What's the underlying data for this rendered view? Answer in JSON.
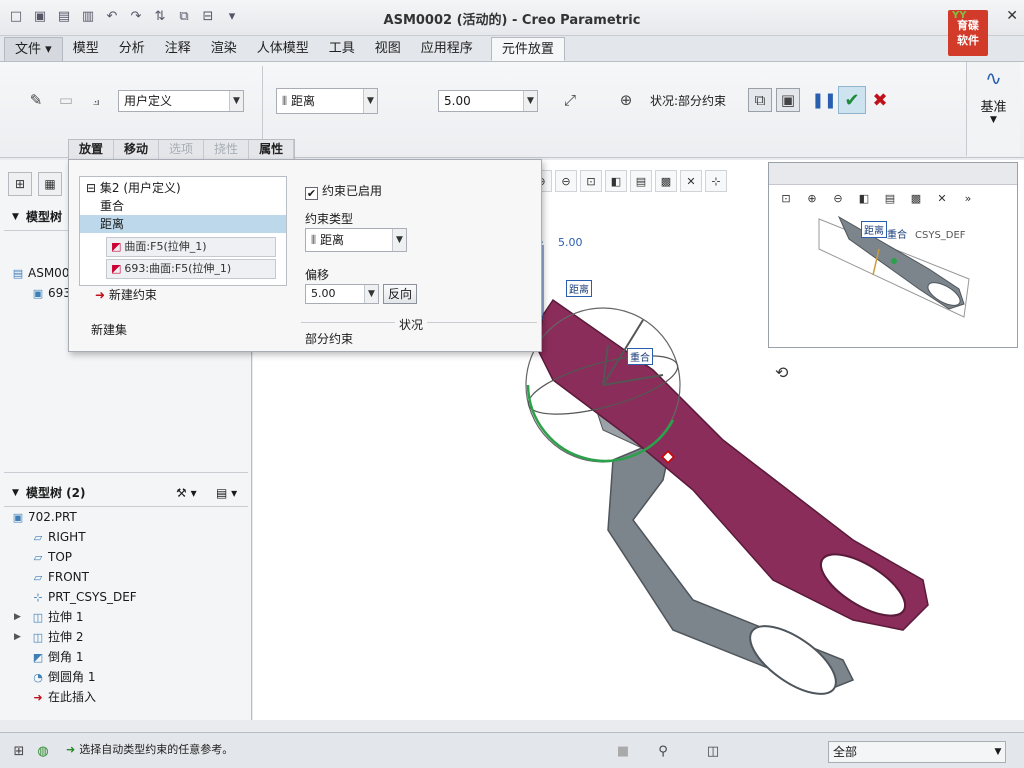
{
  "window": {
    "title": "ASM0002 (活动的) - Creo Parametric"
  },
  "logo": {
    "text_line1": "育碟",
    "text_line2": "软件"
  },
  "menu": {
    "file": "文件",
    "tabs": [
      "模型",
      "分析",
      "注释",
      "渲染",
      "人体模型",
      "工具",
      "视图",
      "应用程序"
    ],
    "active_tab": "元件放置"
  },
  "ribbon": {
    "constraint_mode": "用户定义",
    "constraint_type": "距离",
    "offset_value": "5.00",
    "status_label": "状况:部分约束",
    "datum_label": "基准"
  },
  "subtabs": {
    "placement": "放置",
    "move": "移动",
    "options": "选项",
    "flexibility": "挠性",
    "properties": "属性"
  },
  "placement_panel": {
    "set_label": "集2 (用户定义)",
    "constraint_coincident": "重合",
    "constraint_distance": "距离",
    "ref1": "曲面:F5(拉伸_1)",
    "ref2": "693:曲面:F5(拉伸_1)",
    "new_constraint": "新建约束",
    "new_set": "新建集",
    "enabled_checkbox": "约束已启用",
    "constraint_type_label": "约束类型",
    "constraint_type_value": "距离",
    "offset_label": "偏移",
    "offset_value": "5.00",
    "flip_button": "反向",
    "status_section": "状况",
    "status_value": "部分约束"
  },
  "model_tree_top": {
    "title": "模型树",
    "root": "ASM00",
    "child": "693"
  },
  "model_tree_bottom": {
    "title": "模型树 (2)",
    "items": [
      "702.PRT",
      "RIGHT",
      "TOP",
      "FRONT",
      "PRT_CSYS_DEF",
      "拉伸 1",
      "拉伸 2",
      "倒角 1",
      "倒圆角 1",
      "在此插入"
    ]
  },
  "viewport": {
    "dim_value": "5.00",
    "tag_distance": "距离",
    "tag_coincident": "重合"
  },
  "mini_window": {
    "tag_distance": "距离",
    "tag_coincident": "重合",
    "csys_label": "CSYS_DEF"
  },
  "statusbar": {
    "message": "选择自动类型约束的任意参考。",
    "filter_value": "全部"
  },
  "colors": {
    "blade_magenta": "#8b2d5a",
    "blade_gray": "#7d858c",
    "accent_blue": "#2a5fb0",
    "selection": "#bcd8ea"
  }
}
